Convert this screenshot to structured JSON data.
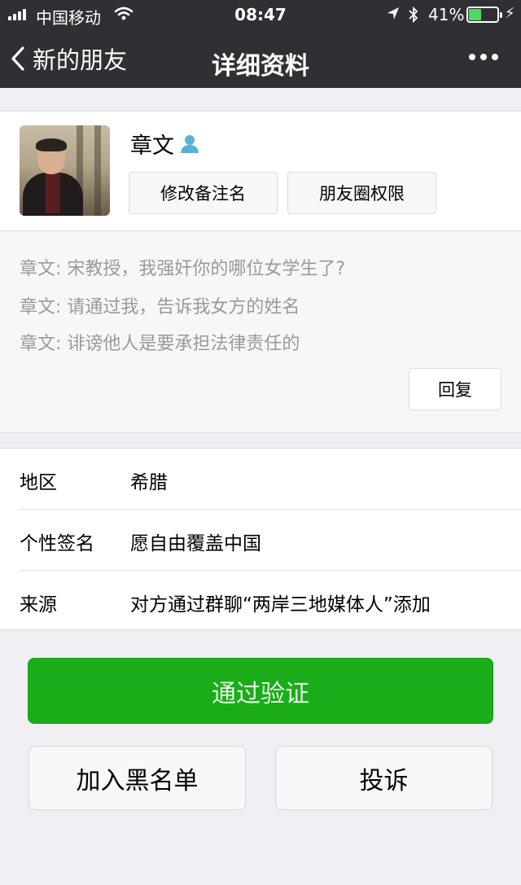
{
  "status_bar": {
    "carrier": "中国移动",
    "time": "08:47",
    "battery_percent": "41%",
    "battery_level": 0.41,
    "battery_color": "#4cd964"
  },
  "nav": {
    "back_label": "新的朋友",
    "title": "详细资料",
    "more_icon": "more-dots-icon"
  },
  "profile": {
    "nickname": "章文",
    "gender_icon": "person-icon",
    "remark_button": "修改备注名",
    "moments_button": "朋友圈权限"
  },
  "messages": {
    "items": [
      "章文: 宋教授，我强奸你的哪位女学生了?",
      "章文: 请通过我，告诉我女方的姓名",
      "章文: 诽谤他人是要承担法律责任的"
    ],
    "reply_button": "回复"
  },
  "info": {
    "rows": [
      {
        "label": "地区",
        "value": "希腊"
      },
      {
        "label": "个性签名",
        "value": "愿自由覆盖中国"
      },
      {
        "label": "来源",
        "value": "对方通过群聊“两岸三地媒体人”添加"
      }
    ]
  },
  "actions": {
    "verify": "通过验证",
    "block": "加入黑名单",
    "report": "投诉",
    "accent_color": "#1aad19"
  }
}
